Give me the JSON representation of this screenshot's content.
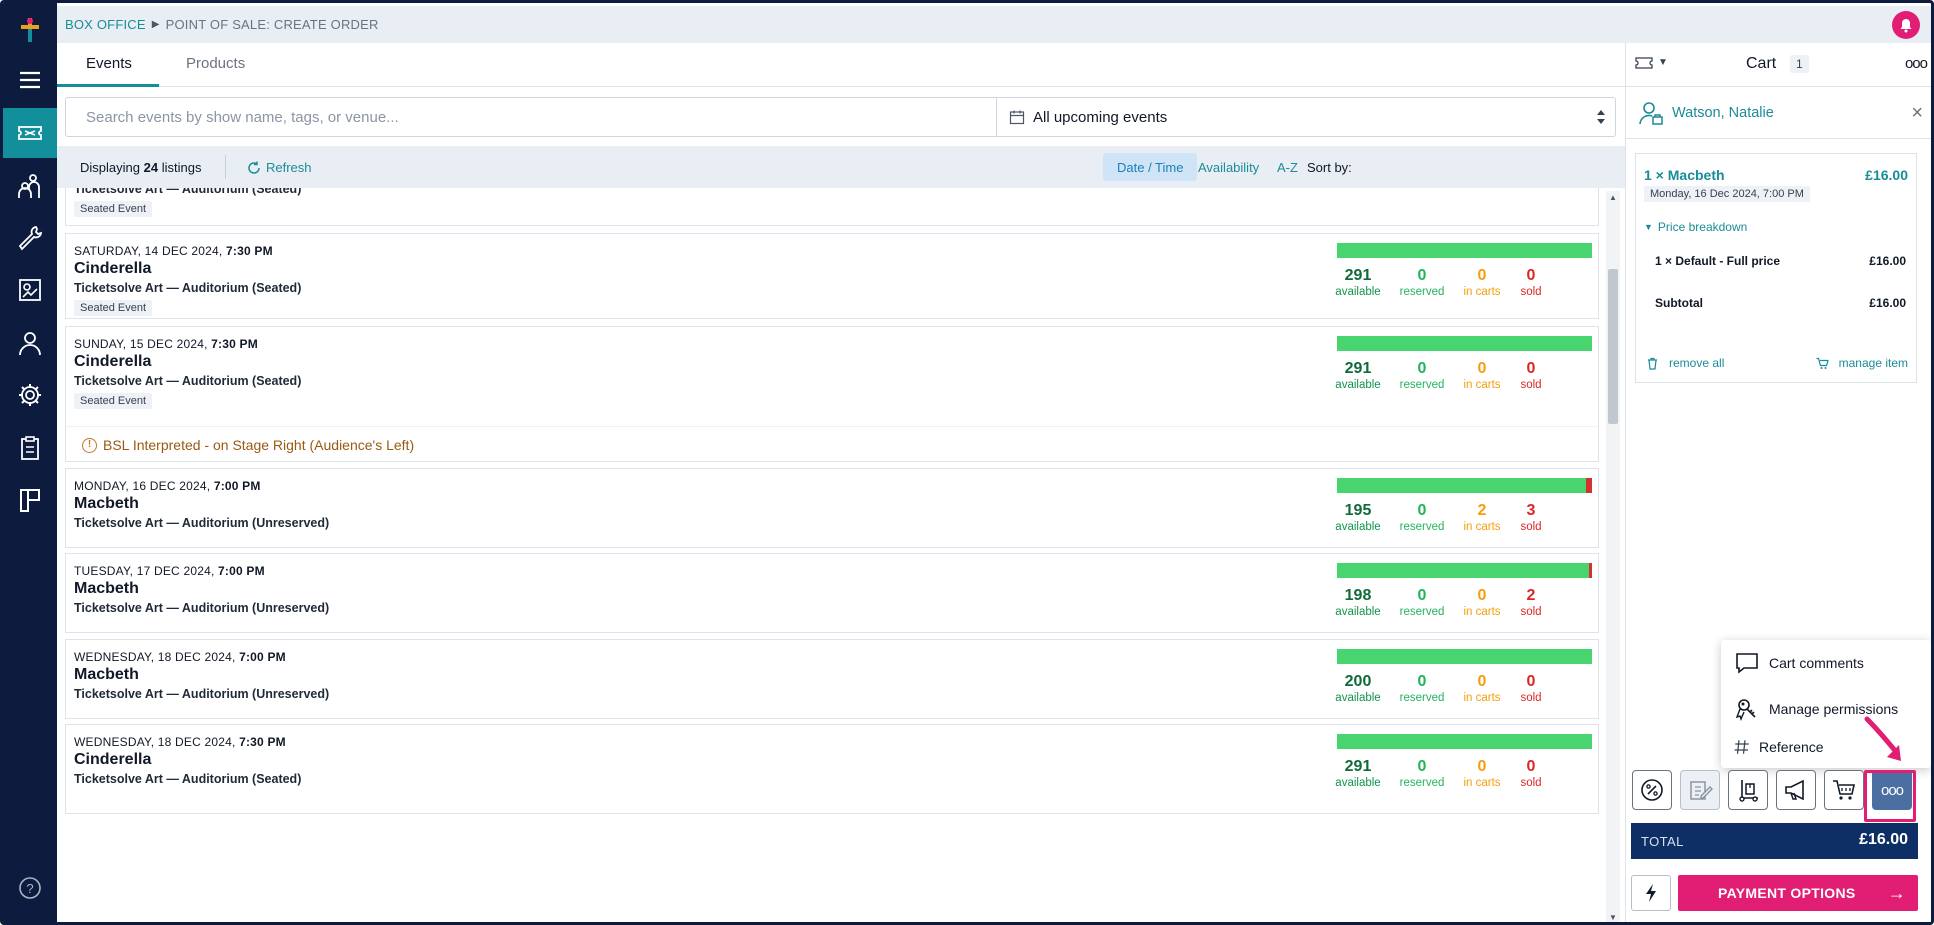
{
  "breadcrumb": {
    "root": "BOX OFFICE",
    "current": "POINT OF SALE: CREATE ORDER"
  },
  "tabs": [
    {
      "label": "Events"
    },
    {
      "label": "Products"
    }
  ],
  "search": {
    "placeholder": "Search events by show name, tags, or venue...",
    "value": ""
  },
  "date_filter": {
    "selected": "All upcoming events"
  },
  "listing_bar": {
    "prefix": "Displaying",
    "count": "24",
    "suffix": "listings",
    "refresh_label": "Refresh",
    "sort_label": "Sort by:",
    "sort_options": [
      "Date / Time",
      "Availability",
      "A-Z"
    ],
    "sort_active": "Date / Time"
  },
  "stat_labels": {
    "available": "available",
    "reserved": "reserved",
    "in_carts": "in carts",
    "sold": "sold"
  },
  "partial_card": {
    "venue": "Ticketsolve Art — Auditorium (Seated)",
    "tag": "Seated Event"
  },
  "events": [
    {
      "date": "SATURDAY, 14 DEC 2024,",
      "time": "7:30 PM",
      "title": "Cinderella",
      "venue": "Ticketsolve Art — Auditorium (Seated)",
      "tag": "Seated Event",
      "available": "291",
      "reserved": "0",
      "in_carts": "0",
      "sold": "0",
      "sold_fraction": 0
    },
    {
      "date": "SUNDAY, 15 DEC 2024,",
      "time": "7:30 PM",
      "title": "Cinderella",
      "venue": "Ticketsolve Art — Auditorium (Seated)",
      "tag": "Seated Event",
      "available": "291",
      "reserved": "0",
      "in_carts": "0",
      "sold": "0",
      "sold_fraction": 0,
      "notice": "BSL Interpreted - on Stage Right (Audience's Left)"
    },
    {
      "date": "MONDAY, 16 DEC 2024,",
      "time": "7:00 PM",
      "title": "Macbeth",
      "venue": "Ticketsolve Art — Auditorium (Unreserved)",
      "available": "195",
      "reserved": "0",
      "in_carts": "2",
      "sold": "3",
      "sold_fraction": 0.025
    },
    {
      "date": "TUESDAY, 17 DEC 2024,",
      "time": "7:00 PM",
      "title": "Macbeth",
      "venue": "Ticketsolve Art — Auditorium (Unreserved)",
      "available": "198",
      "reserved": "0",
      "in_carts": "0",
      "sold": "2",
      "sold_fraction": 0.01
    },
    {
      "date": "WEDNESDAY, 18 DEC 2024,",
      "time": "7:00 PM",
      "title": "Macbeth",
      "venue": "Ticketsolve Art — Auditorium (Unreserved)",
      "available": "200",
      "reserved": "0",
      "in_carts": "0",
      "sold": "0",
      "sold_fraction": 0
    },
    {
      "date": "WEDNESDAY, 18 DEC 2024,",
      "time": "7:30 PM",
      "title": "Cinderella",
      "venue": "Ticketsolve Art — Auditorium (Seated)",
      "available": "291",
      "reserved": "0",
      "in_carts": "0",
      "sold": "0",
      "sold_fraction": 0
    }
  ],
  "cart": {
    "title": "Cart",
    "count": "1",
    "more": "ooo",
    "customer": "Watson, Natalie",
    "close": "×",
    "item": {
      "name": "1 × Macbeth",
      "price": "£16.00",
      "datetime": "Monday, 16 Dec 2024, 7:00 PM",
      "breakdown_label": "Price breakdown",
      "line_label": "1 × Default - Full price",
      "line_price": "£16.00",
      "subtotal_label": "Subtotal",
      "subtotal": "£16.00",
      "remove_all": "remove all",
      "manage_item": "manage item"
    },
    "menu": [
      "Cart comments",
      "Manage permissions",
      "Reference"
    ],
    "tools_more": "ooo",
    "total_label": "TOTAL",
    "total": "£16.00",
    "payment_button": "PAYMENT OPTIONS",
    "payment_arrow": "→"
  },
  "colors": {
    "nav": "#0d1b3e",
    "accent": "#138f9c",
    "link": "#1a8c97",
    "brand_pink": "#e11d74",
    "total_bg": "#0d2f66",
    "available_bar": "#48d46f",
    "sold": "#dc2626",
    "in_carts": "#f59e0b"
  },
  "icons": {
    "nav": [
      "menu-icon",
      "ticket-icon",
      "people-icon",
      "wrench-icon",
      "report-icon",
      "user-icon",
      "gear-icon",
      "clipboard-icon",
      "layout-icon",
      "help-icon"
    ],
    "tools": [
      "discount-icon",
      "edit-icon",
      "delivery-icon",
      "megaphone-icon",
      "basket-icon",
      "more-icon"
    ]
  }
}
